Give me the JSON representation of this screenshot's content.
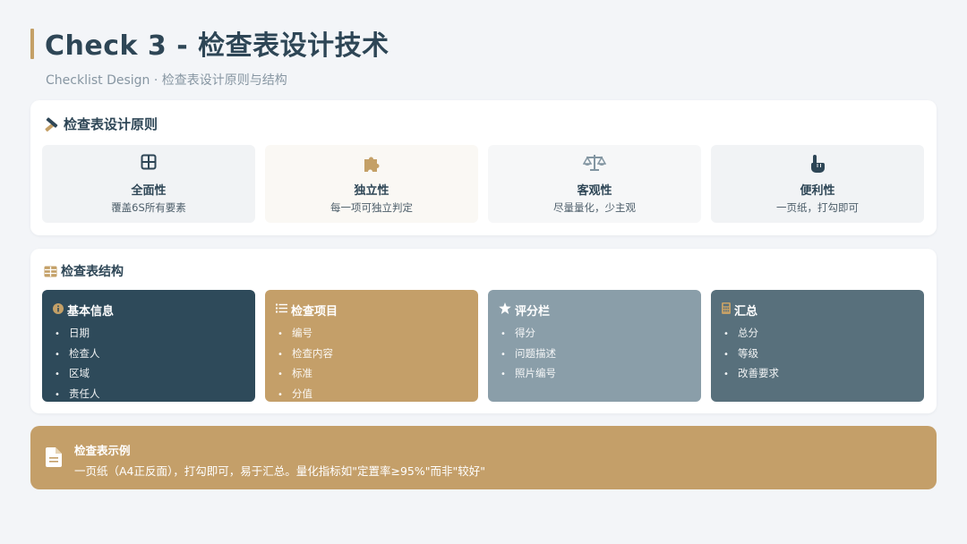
{
  "header": {
    "title": "Check 3 - 检查表设计技术",
    "subtitle": "Checklist Design · 检查表设计原则与结构"
  },
  "principles": {
    "heading": "检查表设计原则",
    "heading_icon": "pencil-ruler-icon",
    "items": [
      {
        "name": "全面性",
        "desc": "覆盖6S所有要素",
        "icon": "grid-icon",
        "bg": "#f1f3f5",
        "icon_color": "#2e4656"
      },
      {
        "name": "独立性",
        "desc": "每一项可独立判定",
        "icon": "puzzle-icon",
        "bg": "#faf8f4",
        "icon_color": "#c4a067"
      },
      {
        "name": "客观性",
        "desc": "尽量量化，少主观",
        "icon": "scale-icon",
        "bg": "#f6f7f8",
        "icon_color": "#8396a2"
      },
      {
        "name": "便利性",
        "desc": "一页纸，打勾即可",
        "icon": "pointer-hand-icon",
        "bg": "#f1f3f5",
        "icon_color": "#2e4656"
      }
    ]
  },
  "structure": {
    "heading": "检查表结构",
    "heading_icon": "table-icon",
    "cards": [
      {
        "title": "基本信息",
        "icon": "info-circle-icon",
        "bg": "#2e4a5a",
        "items": [
          "日期",
          "检查人",
          "区域",
          "责任人"
        ]
      },
      {
        "title": "检查项目",
        "icon": "list-icon",
        "bg": "#c49f69",
        "items": [
          "编号",
          "检查内容",
          "标准",
          "分值"
        ]
      },
      {
        "title": "评分栏",
        "icon": "star-icon",
        "bg": "#8a9ea9",
        "items": [
          "得分",
          "问题描述",
          "照片编号"
        ]
      },
      {
        "title": "汇总",
        "icon": "calculator-icon",
        "bg": "#58707c",
        "items": [
          "总分",
          "等级",
          "改善要求"
        ]
      }
    ]
  },
  "example": {
    "title": "检查表示例",
    "text": "一页纸（A4正反面），打勾即可，易于汇总。量化指标如\"定置率≥95%\"而非\"较好\"",
    "icon": "document-icon"
  },
  "colors": {
    "accent": "#c4a067",
    "dark": "#2e4656"
  }
}
